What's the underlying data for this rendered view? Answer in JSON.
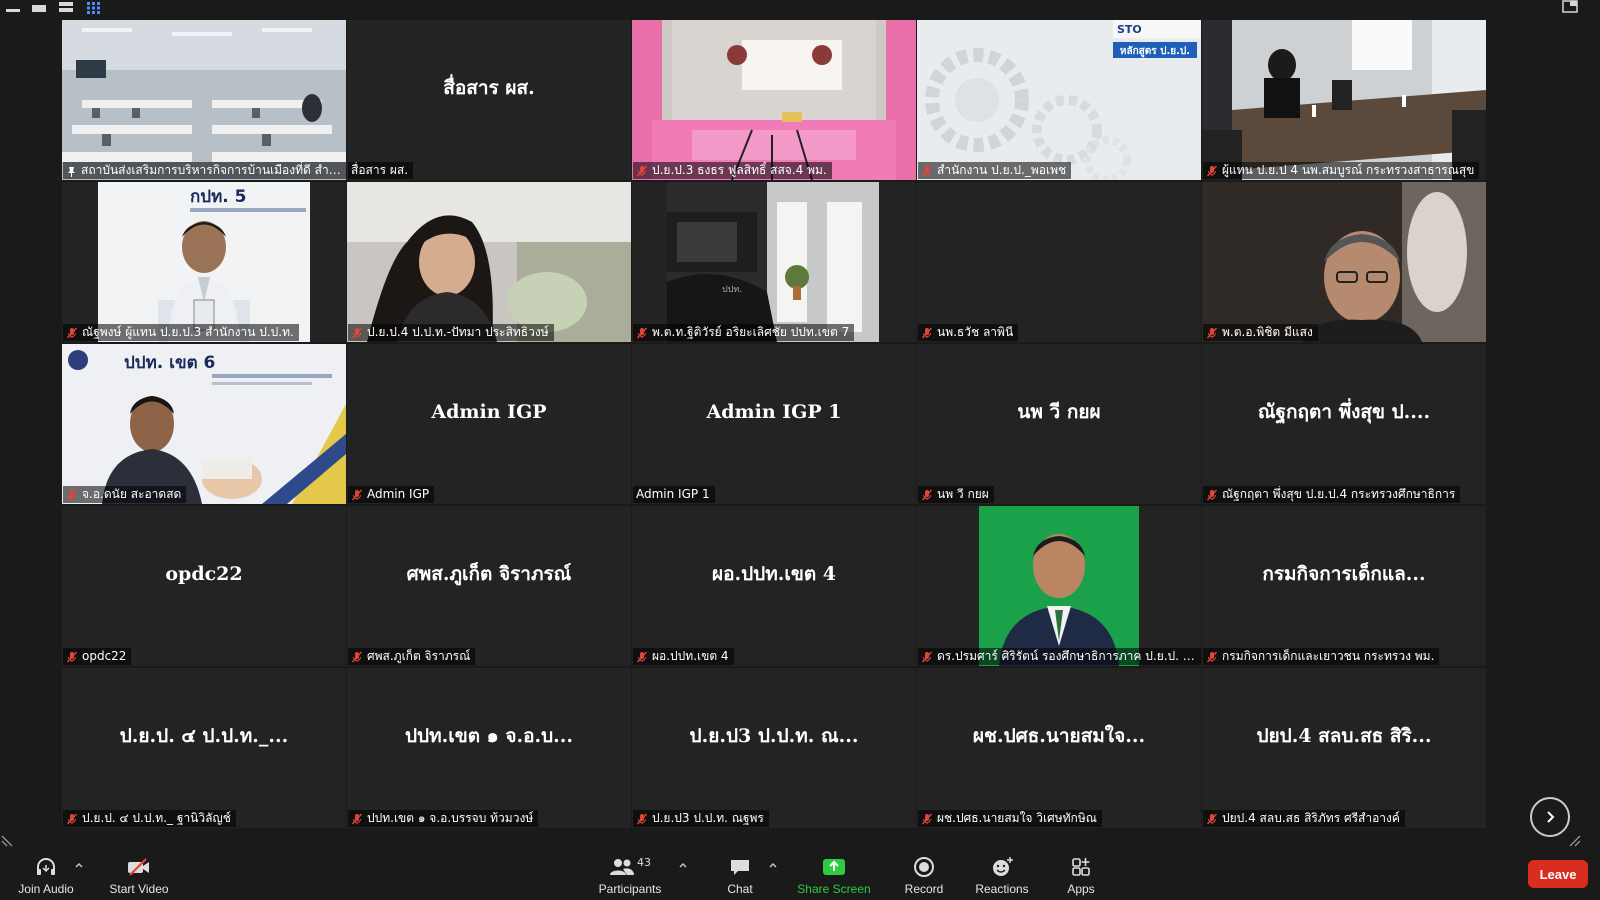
{
  "colors": {
    "active_outline": "#d6e35a",
    "leave": "#d92d20",
    "share": "#2ecc40",
    "mute": "#e0453a"
  },
  "tiles": [
    {
      "name": "",
      "label": "สถาบันส่งเสริมการบริหารกิจการบ้านเมืองที่ดี สำนักง...",
      "muted": false,
      "pinned": true,
      "video": "classroom"
    },
    {
      "name": "สื่อสาร ผส.",
      "label": "สื่อสาร ผส.",
      "muted": false,
      "pinned": false,
      "video": ""
    },
    {
      "name": "",
      "label": "ป.ย.ป.3 ธงธร ฟูลสิทธิ์ สสจ.4 พม.",
      "muted": true,
      "pinned": false,
      "video": "pinkroom"
    },
    {
      "name": "",
      "label": "สำนักงาน ป.ย.ป._พอเพช",
      "muted": true,
      "pinned": false,
      "video": "gear"
    },
    {
      "name": "",
      "label": "ผู้แทน ป.ย.ป 4 นพ.สมบูรณ์ กระทรวงสาธารณสุข",
      "muted": true,
      "pinned": false,
      "video": "meeting"
    },
    {
      "name": "",
      "label": "ณัฐพงษ์ ผู้แทน ป.ย.ป.3 สำนักงาน ป.ป.ท.",
      "muted": true,
      "pinned": false,
      "video": "man-white"
    },
    {
      "name": "",
      "label": "ป.ย.ป.4 ป.ป.ท.-ปัทมา ประสิทธิวงษ์",
      "muted": true,
      "pinned": false,
      "video": "woman"
    },
    {
      "name": "",
      "label": "พ.ต.ท.ฐิติวัรย์ อริยะเลิศชัย ปปท.เขต 7",
      "muted": true,
      "pinned": false,
      "video": "office"
    },
    {
      "name": "",
      "label": "นพ.ธวัช ลาพินี",
      "muted": true,
      "pinned": false,
      "video": ""
    },
    {
      "name": "",
      "label": "พ.ต.อ.พิชิต มีแสง",
      "muted": true,
      "pinned": false,
      "video": "man-glasses"
    },
    {
      "name": "",
      "label": "จ.อ.ดนัย สะอาดสด",
      "muted": true,
      "pinned": false,
      "video": "man-6"
    },
    {
      "name": "Admin IGP",
      "label": "Admin IGP",
      "muted": true,
      "pinned": false,
      "video": ""
    },
    {
      "name": "Admin IGP 1",
      "label": "Admin IGP 1",
      "muted": false,
      "pinned": false,
      "video": ""
    },
    {
      "name": "นพ วี กยผ",
      "label": "นพ วี กยผ",
      "muted": true,
      "pinned": false,
      "video": ""
    },
    {
      "name": "ณัฐกฤตา พึ่งสุข ป....",
      "label": "ณัฐกฤตา พึ่งสุข ป.ย.ป.4 กระทรวงศึกษาธิการ",
      "muted": true,
      "pinned": false,
      "video": ""
    },
    {
      "name": "opdc22",
      "label": "opdc22",
      "muted": true,
      "pinned": false,
      "video": ""
    },
    {
      "name": "ศพส.ภูเก็ต จิราภรณ์",
      "label": "ศพส.ภูเก็ต จิราภรณ์",
      "muted": true,
      "pinned": false,
      "video": ""
    },
    {
      "name": "ผอ.ปปท.เขต 4",
      "label": "ผอ.ปปท.เขต 4",
      "muted": true,
      "pinned": false,
      "video": ""
    },
    {
      "name": "",
      "label": "ดร.ปรมศาร์ ศิริรัตน์ รองศึกษาธิการภาค ป.ย.ป. 3กร...",
      "muted": true,
      "pinned": false,
      "video": "portrait-green"
    },
    {
      "name": "กรมกิจการเด็กแล...",
      "label": "กรมกิจการเด็กและเยาวชน กระทรวง พม.",
      "muted": true,
      "pinned": false,
      "video": ""
    },
    {
      "name": "ป.ย.ป. ๔ ป.ป.ท._...",
      "label": "ป.ย.ป. ๔ ป.ป.ท._ ฐานิวิลัญช์",
      "muted": true,
      "pinned": false,
      "video": ""
    },
    {
      "name": "ปปท.เขต ๑ จ.อ.บ...",
      "label": "ปปท.เขต ๑ จ.อ.บรรจบ ท้วมวงษ์",
      "muted": true,
      "pinned": false,
      "video": ""
    },
    {
      "name": "ป.ย.ป3 ป.ป.ท. ณ...",
      "label": "ป.ย.ป3 ป.ป.ท. ณฐพร",
      "muted": true,
      "pinned": false,
      "video": ""
    },
    {
      "name": "ผช.ปศธ.นายสมใจ...",
      "label": "ผช.ปศธ.นายสมใจ วิเศษทักษิณ",
      "muted": true,
      "pinned": false,
      "video": ""
    },
    {
      "name": "ปยป.4 สลบ.สธ สิริ...",
      "label": "ปยป.4 สลบ.สธ สิริภัทร ศรีสำอางค์",
      "muted": true,
      "pinned": false,
      "video": ""
    }
  ],
  "video_text": {
    "tile6_sign": "กปท. 5",
    "tile11_sign": "ปปท. เขต 6",
    "tile4_sign": "หลักสูตร ป.ย.ป."
  },
  "toolbar": {
    "join_audio": "Join Audio",
    "start_video": "Start Video",
    "participants": "Participants",
    "participants_count": "43",
    "chat": "Chat",
    "share_screen": "Share Screen",
    "record": "Record",
    "reactions": "Reactions",
    "apps": "Apps",
    "leave": "Leave"
  },
  "icons": {
    "view_modes": [
      "minimize-icon",
      "speaker-view-icon",
      "strip-view-icon",
      "gallery-view-icon"
    ],
    "next_page": "chevron-right-icon",
    "exit_fullscreen": "exit-fullscreen-icon"
  }
}
